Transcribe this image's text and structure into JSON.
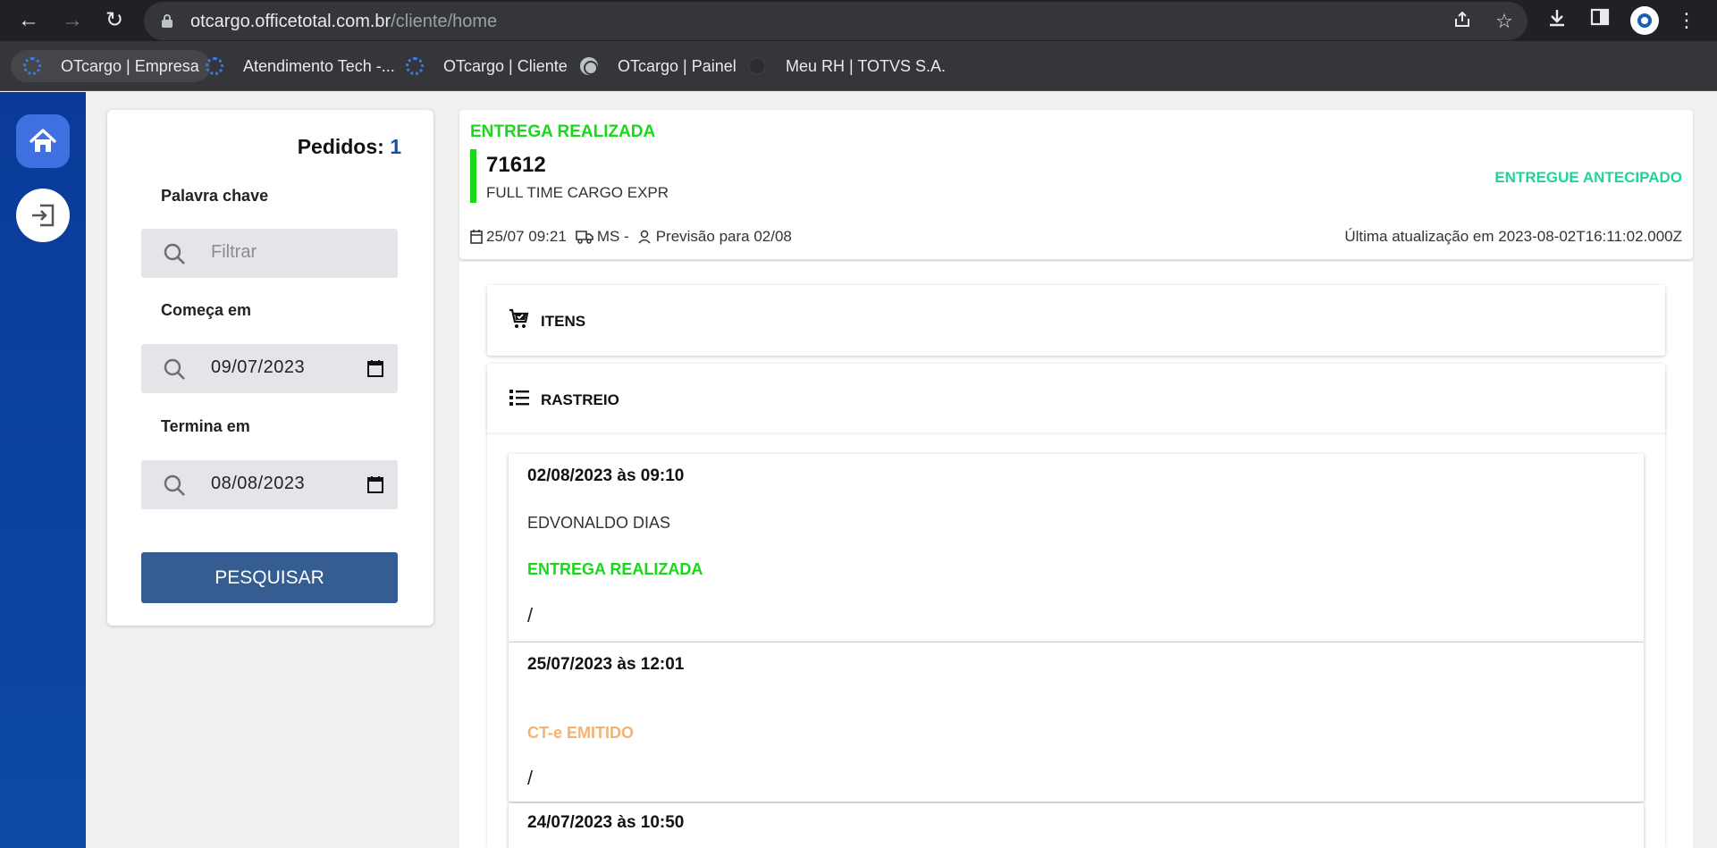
{
  "browser": {
    "url_host": "otcargo.officetotal.com.br",
    "url_path": "/cliente/home",
    "bookmarks": [
      {
        "label": "OTcargo | Empresa",
        "icon": "otcargo-favicon"
      },
      {
        "label": "Atendimento Tech -...",
        "icon": "otcargo-favicon"
      },
      {
        "label": "OTcargo | Cliente",
        "icon": "otcargo-favicon"
      },
      {
        "label": "OTcargo | Painel",
        "icon": "globe-icon"
      },
      {
        "label": "Meu RH | TOTVS S.A.",
        "icon": "totvs-favicon"
      }
    ]
  },
  "filters": {
    "pedidos_label": "Pedidos:",
    "pedidos_count": "1",
    "keyword_label": "Palavra chave",
    "keyword_placeholder": "Filtrar",
    "start_label": "Começa em",
    "start_value": "09/07/2023",
    "end_label": "Termina em",
    "end_value": "08/08/2023",
    "search_button": "PESQUISAR"
  },
  "order": {
    "status": "ENTREGA REALIZADA",
    "number": "71612",
    "carrier": "FULL TIME CARGO EXPR",
    "delivery_badge": "ENTREGUE ANTECIPADO",
    "date": "25/07 09:21",
    "route": "MS -",
    "forecast": "Previsão para 02/08",
    "last_update": "Última atualização em 2023-08-02T16:11:02.000Z"
  },
  "sections": {
    "items_title": "ITENS",
    "tracking_title": "RASTREIO"
  },
  "tracking": [
    {
      "date": "02/08/2023 às 09:10",
      "person": "EDVONALDO DIAS",
      "status": "ENTREGA REALIZADA",
      "status_color": "#19d81a",
      "note": "/"
    },
    {
      "date": "25/07/2023 às 12:01",
      "person": "",
      "status": "CT-e EMITIDO",
      "status_color": "#f7b26b",
      "note": "/"
    },
    {
      "date": "24/07/2023 às 10:50"
    }
  ],
  "colors": {
    "sidebar": "#0a3a99",
    "home_button": "#3f6fe0",
    "search_button": "#355d92",
    "delivered_green": "#19d81a",
    "early_teal": "#1fd39a",
    "pedidos_count": "#1a4d9c"
  }
}
